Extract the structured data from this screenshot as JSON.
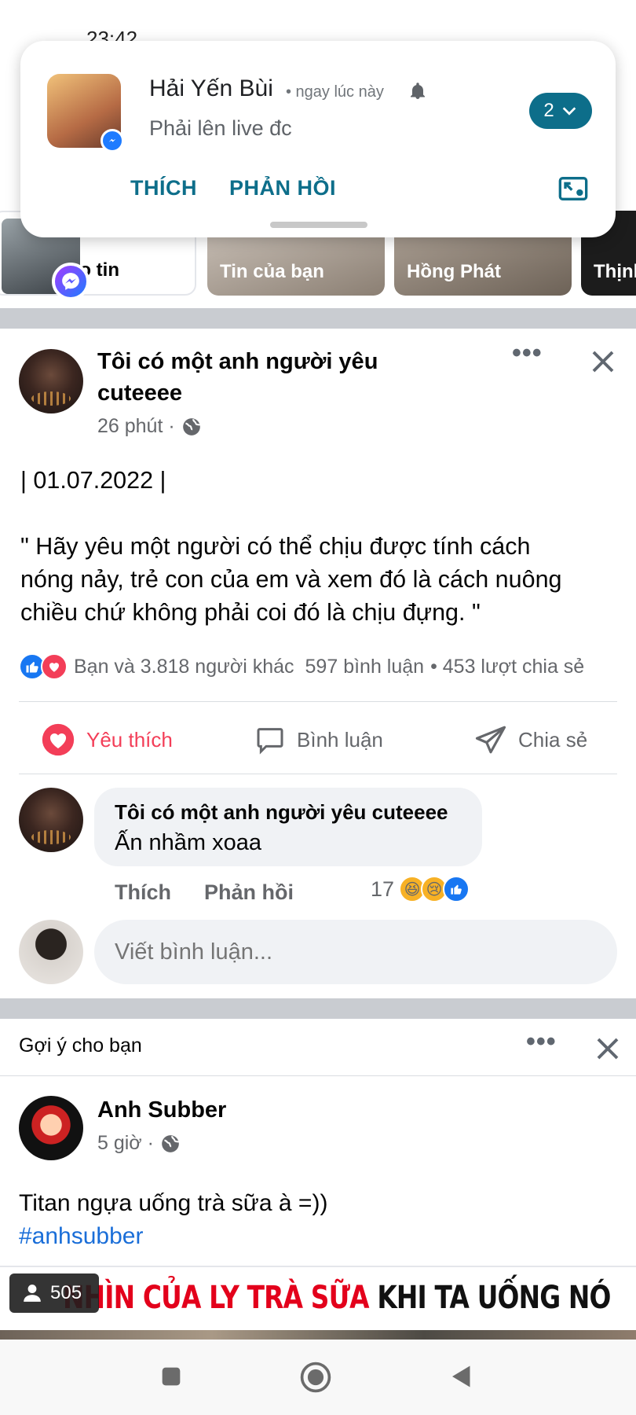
{
  "status_bar": {
    "time": "23:42"
  },
  "notification": {
    "sender": "Hải Yến Bùi",
    "time": "• ngay lúc này",
    "message": "Phải lên live đc",
    "count": "2",
    "actions": [
      "THÍCH",
      "PHẢN HỒI"
    ],
    "icons": [
      "messenger-icon",
      "bell-icon",
      "chevron-down-icon",
      "picture-in-picture-icon"
    ],
    "accent": "#0d6e8a"
  },
  "stories": [
    {
      "label": "ạo tin"
    },
    {
      "label": "Tin của bạn"
    },
    {
      "label": "Hồng Phát"
    },
    {
      "label": "Thịnh"
    }
  ],
  "post": {
    "author": "Tôi có một anh người yêu cuteeee",
    "time": "26 phút ·",
    "date_line": "| 01.07.2022 |",
    "quote_lines": [
      "\" Hãy yêu một người có thể chịu được tính cách",
      "nóng nảy, trẻ con của em và xem đó là cách nuông",
      "chiều chứ không phải coi đó là chịu đựng. \""
    ],
    "reactions_text": "Bạn và 3.818 người khác",
    "comments_count": "597 bình luận",
    "shares_count": "• 453 lượt chia sẻ",
    "actions": {
      "love": "Yêu thích",
      "comment": "Bình luận",
      "share": "Chia sẻ"
    },
    "love_color": "#f33e58"
  },
  "comment": {
    "author": "Tôi có một anh người yêu cuteeee",
    "text": "Ấn nhầm xoaa",
    "like": "Thích",
    "reply": "Phản hồi",
    "reaction_count": "17"
  },
  "write_comment_placeholder": "Viết bình luận...",
  "suggested": {
    "label": "Gợi ý cho bạn",
    "author": "Anh Subber",
    "time": "5 giờ ·",
    "text": "Titan ngựa uống trà sữa à =))",
    "hashtag": "#anhsubber",
    "banner_red_1": "NHÌN CỦA LY TRÀ SỮA",
    "banner_black": " KHI TA UỐNG NÓ",
    "viewers": "505"
  },
  "colors": {
    "fb_blue": "#1877f2",
    "divider": "#c9ccd1",
    "bubble": "#f0f2f5"
  }
}
